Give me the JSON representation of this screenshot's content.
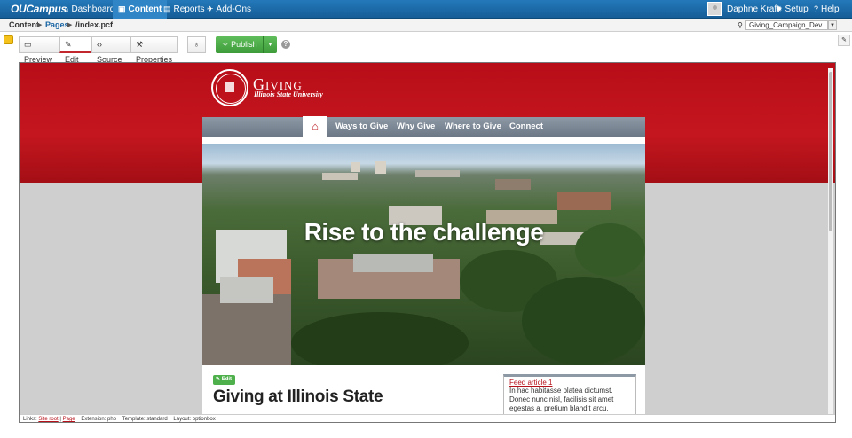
{
  "topbar": {
    "logo": "OUCampus",
    "nav": [
      {
        "label": "Dashboard",
        "icon": "home-icon"
      },
      {
        "label": "Content",
        "icon": "content-icon",
        "active": true
      },
      {
        "label": "Reports",
        "icon": "clipboard-icon"
      },
      {
        "label": "Add-Ons",
        "icon": "plane-icon"
      }
    ],
    "user": "Daphne Kraft",
    "setup": "Setup",
    "help": "Help"
  },
  "breadcrumb": {
    "root": "Content",
    "pages": "Pages",
    "file": "/index.pcf"
  },
  "site_selector": {
    "value": "Giving_Campaign_Dev"
  },
  "toolbar": {
    "preview": "Preview",
    "edit": "Edit",
    "source": "Source",
    "properties": "Properties",
    "publish": "Publish"
  },
  "preview": {
    "brand_title": "Giving",
    "brand_subtitle": "Illinois State University",
    "menu": [
      "Ways to Give",
      "Why Give",
      "Where to Give",
      "Connect"
    ],
    "hero_text": "Rise to the challenge",
    "edit_label": "Edit",
    "page_title": "Giving at Illinois State",
    "feed": {
      "link": "Feed article 1",
      "text": "In hac habitasse platea dictumst. Donec nunc nisl, facilisis sit amet egestas a, pretium blandit arcu."
    }
  },
  "status": {
    "links_label": "Links:",
    "site_root": "Site root",
    "page": "Page",
    "extension": "Extension: php",
    "template": "Template: standard",
    "layout": "Layout: optionbox"
  },
  "colors": {
    "brand_red": "#c4161f",
    "topbar_blue": "#1a66a4",
    "publish_green": "#4caf48"
  }
}
